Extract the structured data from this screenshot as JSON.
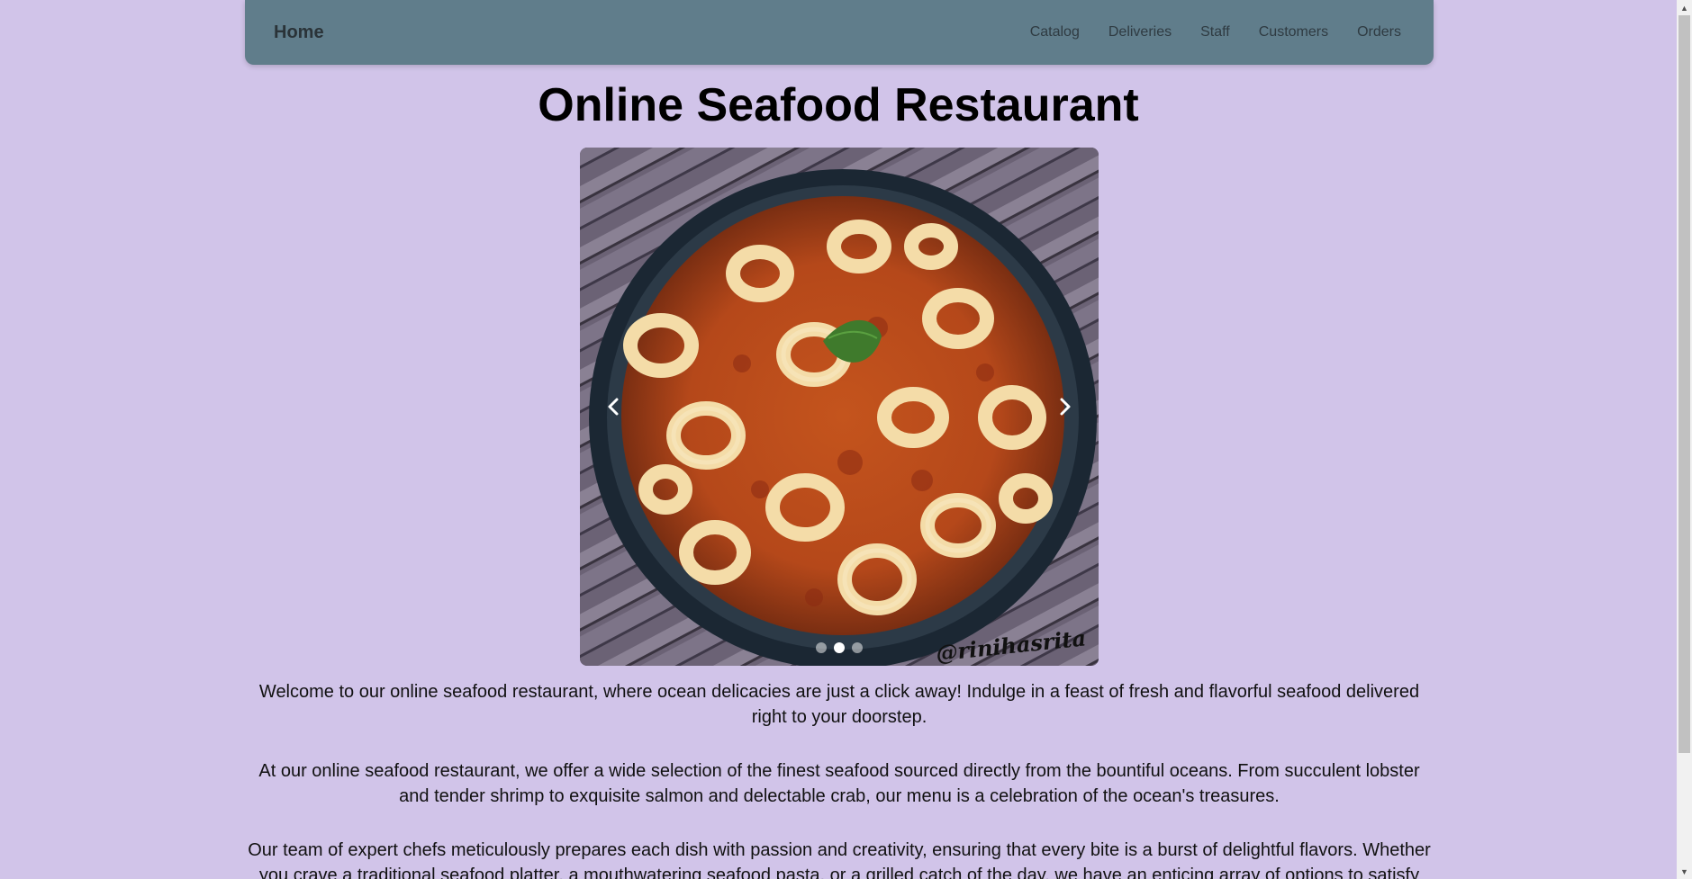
{
  "navbar": {
    "brand": "Home",
    "links": [
      "Catalog",
      "Deliveries",
      "Staff",
      "Customers",
      "Orders"
    ]
  },
  "hero": {
    "title": "Online Seafood Restaurant"
  },
  "carousel": {
    "watermark": "@rinihasrita",
    "slide_count": 3,
    "active_slide": 2,
    "prev_icon": "chevron-left-icon",
    "next_icon": "chevron-right-icon"
  },
  "content": {
    "paragraphs": [
      "Welcome to our online seafood restaurant, where ocean delicacies are just a click away! Indulge in a feast of fresh and flavorful seafood delivered right to your doorstep.",
      "At our online seafood restaurant, we offer a wide selection of the finest seafood sourced directly from the bountiful oceans. From succulent lobster and tender shrimp to exquisite salmon and delectable crab, our menu is a celebration of the ocean's treasures.",
      "Our team of expert chefs meticulously prepares each dish with passion and creativity, ensuring that every bite is a burst of delightful flavors. Whether you crave a traditional seafood platter, a mouthwatering seafood pasta, or a grilled catch of the day, we have an enticing array of options to satisfy"
    ]
  },
  "colors": {
    "page_background": "#d1c4e9",
    "navbar_background": "#607d8b"
  }
}
